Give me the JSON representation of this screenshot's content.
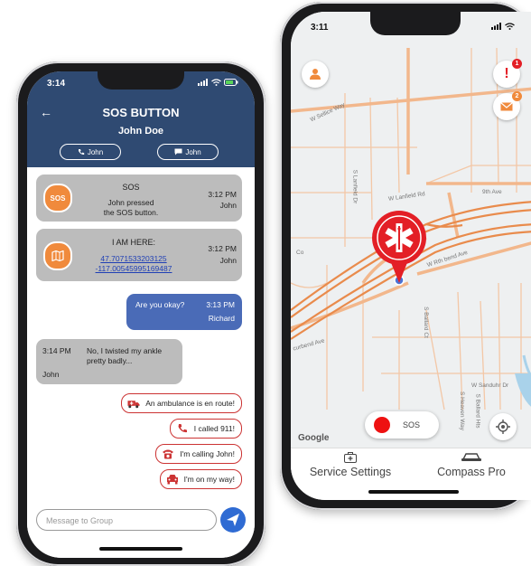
{
  "left_phone": {
    "status_time": "3:14",
    "header": {
      "title": "SOS BUTTON",
      "subtitle": "John Doe",
      "call_button_label": "John",
      "message_button_label": "John"
    },
    "messages": [
      {
        "icon_text": "SOS",
        "title": "SOS",
        "body_line1": "John pressed",
        "body_line2": "the SOS button.",
        "time": "3:12 PM",
        "sender": "John"
      },
      {
        "title": "I AM HERE:",
        "link_line1": "47.7071533203125",
        "link_line2": "-117.00545995169487",
        "time": "3:12 PM",
        "sender": "John"
      },
      {
        "text": "Are you okay?",
        "time": "3:13 PM",
        "sender": "Richard"
      },
      {
        "time": "3:14 PM",
        "text_line1": "No, I twisted my ankle",
        "text_line2": "pretty badly...",
        "sender": "John"
      }
    ],
    "quick_replies": [
      {
        "label": "An ambulance is en route!",
        "icon": "ambulance-icon"
      },
      {
        "label": "I called 911!",
        "icon": "phone-icon"
      },
      {
        "label": "I'm calling John!",
        "icon": "telephone-icon"
      },
      {
        "label": "I'm on my way!",
        "icon": "car-icon"
      }
    ],
    "input_placeholder": "Message to Group",
    "colors": {
      "header": "#2f4a72",
      "bubble_gray": "#bcbcbc",
      "bubble_blue": "#4a6bb7",
      "accent_orange": "#f08a3c",
      "send": "#2f6bd3"
    }
  },
  "right_phone": {
    "status_time": "3:11",
    "badges": {
      "alert": "1",
      "mail": "2"
    },
    "road_labels": {
      "w_sellice_way": "W Sellice Way",
      "ninth_ave": "9th Ave",
      "w_lanfield_rd": "W Lanfield Rd",
      "w_rth_bend_ave": "W Rth bend Ave",
      "curbend_ave": "curbend Ave",
      "w_sanduhr_dr": "W Sanduhr Dr",
      "s_lanfield_dr": "S Lanfield Dr",
      "s_ballard_ct": "S Ballard Ct",
      "co": "Co",
      "s_heaven_way": "S Heaven Way",
      "s_ballard_hts": "S Ballard Hts"
    },
    "map_attribution": "Google",
    "sos_label": "SOS",
    "tabs": [
      {
        "label": "Service Settings",
        "icon": "medical-kit-icon"
      },
      {
        "label": "Compass Pro",
        "icon": "car-icon"
      }
    ],
    "colors": {
      "roads": "#f3b98f",
      "main_roads": "#e98b4c",
      "marker": "#e31f26",
      "sos_dot": "#ee1111",
      "orange": "#f08a3c",
      "water": "#a9d2ea"
    }
  }
}
